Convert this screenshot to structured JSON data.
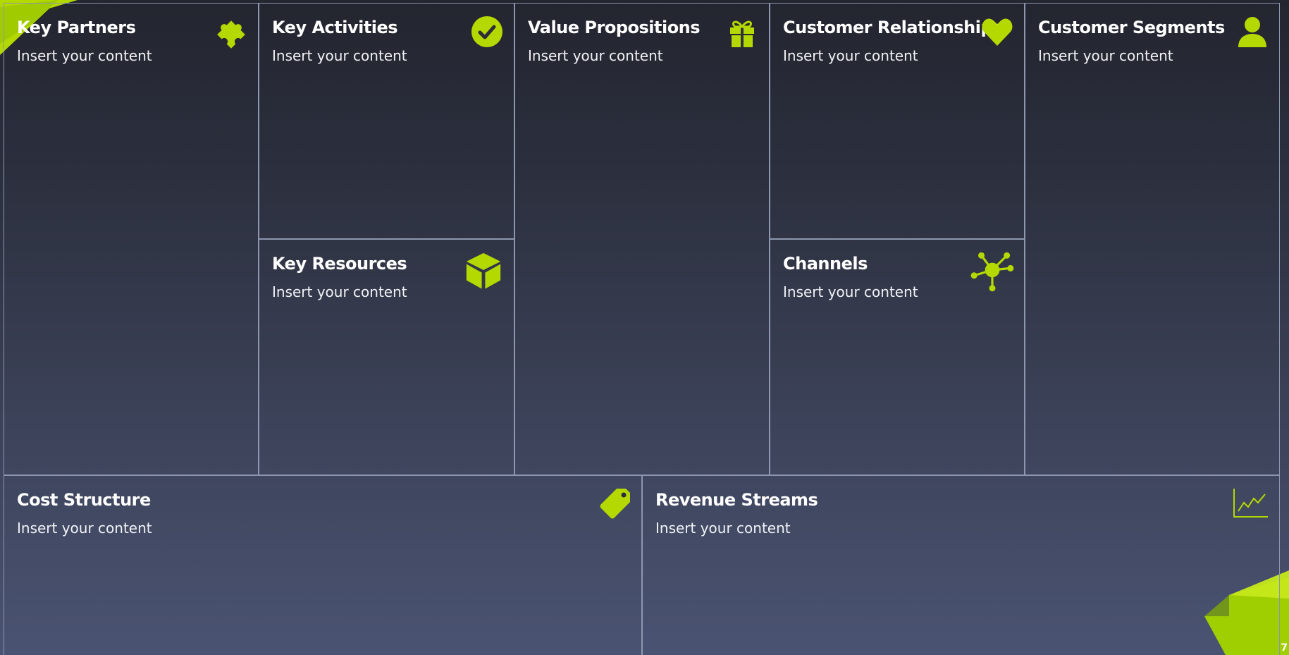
{
  "canvas": {
    "blocks": [
      {
        "id": "key-partners",
        "title": "Key Partners",
        "content": "Insert your content",
        "icon": "puzzle-icon"
      },
      {
        "id": "key-activities",
        "title": "Key Activities",
        "content": "Insert your content",
        "icon": "checkmark-circle-icon"
      },
      {
        "id": "value-propositions",
        "title": "Value Propositions",
        "content": "Insert your content",
        "icon": "gift-icon"
      },
      {
        "id": "customer-relationships",
        "title": "Customer Relationships",
        "content": "Insert your content",
        "icon": "heart-icon"
      },
      {
        "id": "customer-segments",
        "title": "Customer Segments",
        "content": "Insert your content",
        "icon": "user-icon"
      },
      {
        "id": "key-resources",
        "title": "Key Resources",
        "content": "Insert your content",
        "icon": "box-icon"
      },
      {
        "id": "channels",
        "title": "Channels",
        "content": "Insert your content",
        "icon": "network-icon"
      },
      {
        "id": "cost-structure",
        "title": "Cost Structure",
        "content": "Insert your content",
        "icon": "price-tag-icon"
      },
      {
        "id": "revenue-streams",
        "title": "Revenue Streams",
        "content": "Insert your content",
        "icon": "line-chart-icon"
      }
    ]
  },
  "page": {
    "number": "7"
  },
  "colors": {
    "accent": "#b4d900",
    "border": "#8d97b0",
    "background_top": "#23252f",
    "background_bottom": "#4a5372",
    "text": "#ffffff"
  }
}
